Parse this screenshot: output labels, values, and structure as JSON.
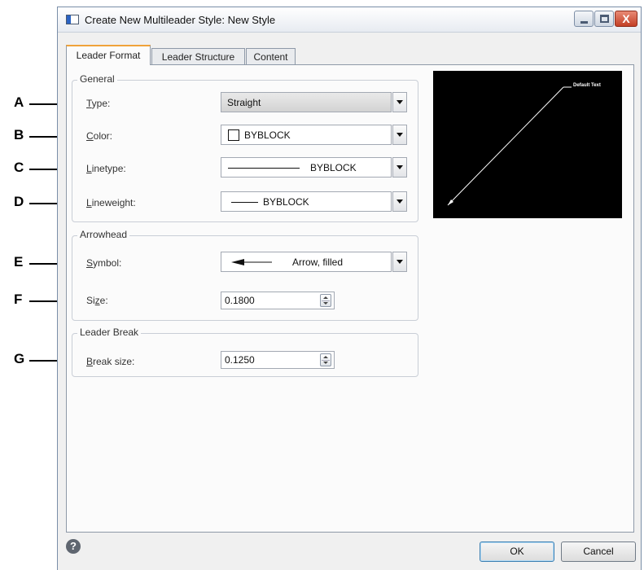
{
  "window": {
    "title": "Create New Multileader Style: New Style",
    "close_glyph": "X"
  },
  "tabs": [
    {
      "label": "Leader Format",
      "active": true
    },
    {
      "label": "Leader Structure",
      "active": false
    },
    {
      "label": "Content",
      "active": false
    }
  ],
  "callouts": [
    "A",
    "B",
    "C",
    "D",
    "E",
    "F",
    "G"
  ],
  "general": {
    "title": "General",
    "type": {
      "mnemonic": "T",
      "rest": "ype:",
      "value": "Straight"
    },
    "color": {
      "mnemonic": "C",
      "rest": "olor:",
      "value": "BYBLOCK"
    },
    "linetype": {
      "mnemonic": "L",
      "rest": "inetype:",
      "value": "BYBLOCK"
    },
    "lineweight": {
      "mnemonic": "L",
      "rest": "ineweight:",
      "value": "BYBLOCK"
    }
  },
  "arrowhead": {
    "title": "Arrowhead",
    "symbol": {
      "mnemonic": "S",
      "rest": "ymbol:",
      "value": "Arrow, filled"
    },
    "size": {
      "before": "Si",
      "mnemonic": "z",
      "after": "e:",
      "value": "0.1800"
    }
  },
  "leader_break": {
    "title": "Leader Break",
    "break_size": {
      "mnemonic": "B",
      "rest": "reak size:",
      "value": "0.1250"
    }
  },
  "preview": {
    "text": "Default Text"
  },
  "buttons": {
    "help_glyph": "?",
    "ok": "OK",
    "cancel": "Cancel"
  }
}
